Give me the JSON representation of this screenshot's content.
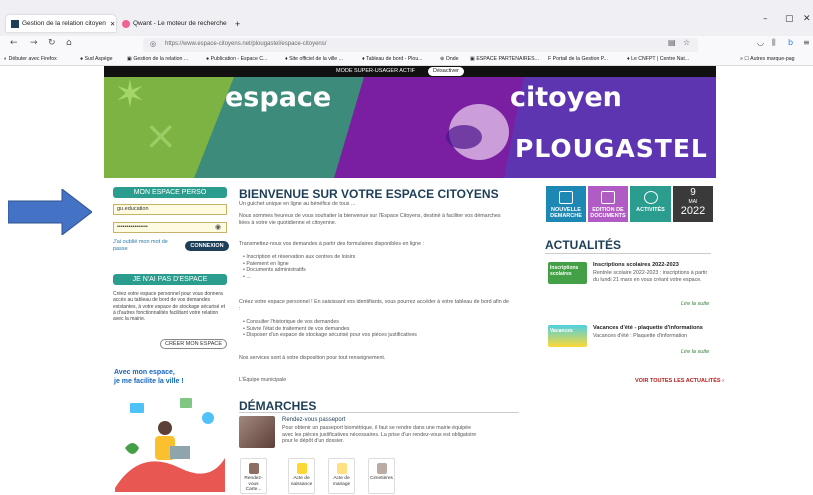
{
  "browser": {
    "tabs": [
      {
        "label": "Gestion de la relation citoyen"
      },
      {
        "label": "Qwant - Le moteur de recherche"
      }
    ],
    "new_tab": "+",
    "url": "https://www.espace-citoyens.net/plougastel/espace-citoyens/",
    "bookmarks": [
      "Débuter avec Firefox",
      "Sud Aspège",
      "Gestion de la relation ...",
      "Publication - Espace C...",
      "Site officiel de la ville ...",
      "Tableau de bord - Plou...",
      "Onde",
      "ESPACE PARTENAIRES...",
      "Portail de la Gestion P...",
      "Le CNFPT | Centre Nat..."
    ],
    "other_bookmarks": "Autres marque-pag"
  },
  "superbar": {
    "label": "MODE SUPER-USAGER ACTIF",
    "button": "Désactiver"
  },
  "banner": {
    "word1": "espace",
    "word2": "citoyen",
    "logo": "PLOUGASTEL"
  },
  "login": {
    "title": "MON ESPACE PERSO",
    "identifiant_value": "gu.education",
    "password_value": "••••••••••••••••",
    "forgot": "J'ai oublié mon mot de passe",
    "connect": "CONNEXION"
  },
  "noaccount": {
    "title": "JE N'AI PAS D'ESPACE",
    "text": "Créez votre espace personnel pour vous donnera accès au tableau de bord de vos demandes existantes, à votre espace de stockage sécurisé et à d'autres fonctionnalités facilitant votre relation avec la mairie.",
    "create": "CRÉER MON ESPACE"
  },
  "slogan": {
    "line1": "Avec mon espace,",
    "line2": "je me facilite la ville !"
  },
  "welcome": {
    "title": "BIENVENUE SUR VOTRE ESPACE CITOYENS",
    "p1": "Un guichet unique en ligne au bénéfice de tous ...",
    "p2": "Nous sommes heureux de vous souhaiter la bienvenue sur l'Espace Citoyens, destiné à faciliter vos démarches liées à votre vie quotidienne et citoyenne.",
    "p3": "Transmettez-nous vos demandes à partir des formulaires disponibles en ligne :",
    "list1": [
      "Inscription et réservation aux centres de loisirs",
      "Paiement en ligne",
      "Documents administratifs",
      "..."
    ],
    "p4": "Créez votre espace personnel ! En saisissant vos identifiants, vous pourrez accéder à votre tableau de bord afin de :",
    "list2": [
      "Consulter l'historique de vos demandes",
      "Suivre l'état de traitement de vos demandes",
      "Disposer d'un espace de stockage sécurisé pour vos pièces justificatives"
    ],
    "p5": "Nos services sont à votre disposition pour tout renseignement.",
    "p6": "L'Équipe municipale"
  },
  "demarches": {
    "title": "DÉMARCHES",
    "pass_title": "Rendez-vous passeport",
    "pass_text": "Pour obtenir un passeport biométrique, il faut se rendre dans une mairie équipée avec les pièces justificatives nécessaires. La prise d'un rendez-vous est obligatoire pour le dépôt d'un dossier.",
    "tiles": [
      "Rendez-vous Carte...",
      "Acte de naissance",
      "Acte de mariage",
      "Cimetières"
    ]
  },
  "tiles": [
    {
      "label": "NOUVELLE DEMARCHE",
      "color": "#1e88b5"
    },
    {
      "label": "EDITION DE DOCUMENTS",
      "color": "#b15bc4"
    },
    {
      "label": "ACTIVITÉS",
      "color": "#2a9d8f"
    }
  ],
  "date": {
    "day": "9",
    "month": "MAI",
    "year": "2022"
  },
  "actualites": {
    "title": "ACTUALITÉS",
    "items": [
      {
        "img_label": "Inscriptions scolaires",
        "title": "Inscriptions scolaires 2022-2023",
        "text": "Rentrée scolaire 2022-2023 : inscriptions à partir du lundi 21 mars en vous créant votre espace.",
        "more": "Lire la suite"
      },
      {
        "img_label": "Vacances",
        "title": "Vacances d'été - plaquette d'informations",
        "text": "Vacances d'été : Plaquette d'information",
        "more": "Lire la suite"
      }
    ],
    "all": "VOIR TOUTES LES ACTUALITÉS"
  }
}
